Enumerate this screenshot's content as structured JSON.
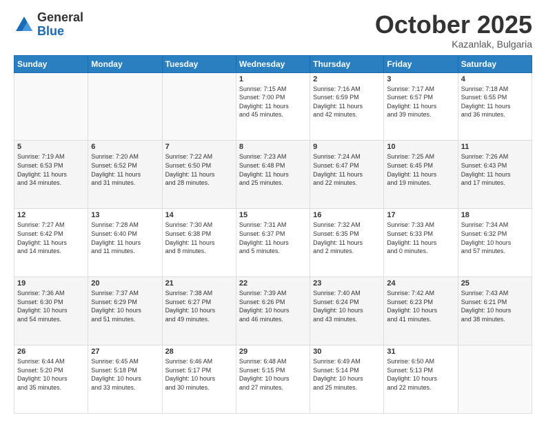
{
  "logo": {
    "general": "General",
    "blue": "Blue"
  },
  "title": {
    "month": "October 2025",
    "location": "Kazanlak, Bulgaria"
  },
  "headers": [
    "Sunday",
    "Monday",
    "Tuesday",
    "Wednesday",
    "Thursday",
    "Friday",
    "Saturday"
  ],
  "weeks": [
    [
      {
        "day": "",
        "info": ""
      },
      {
        "day": "",
        "info": ""
      },
      {
        "day": "",
        "info": ""
      },
      {
        "day": "1",
        "info": "Sunrise: 7:15 AM\nSunset: 7:00 PM\nDaylight: 11 hours\nand 45 minutes."
      },
      {
        "day": "2",
        "info": "Sunrise: 7:16 AM\nSunset: 6:59 PM\nDaylight: 11 hours\nand 42 minutes."
      },
      {
        "day": "3",
        "info": "Sunrise: 7:17 AM\nSunset: 6:57 PM\nDaylight: 11 hours\nand 39 minutes."
      },
      {
        "day": "4",
        "info": "Sunrise: 7:18 AM\nSunset: 6:55 PM\nDaylight: 11 hours\nand 36 minutes."
      }
    ],
    [
      {
        "day": "5",
        "info": "Sunrise: 7:19 AM\nSunset: 6:53 PM\nDaylight: 11 hours\nand 34 minutes."
      },
      {
        "day": "6",
        "info": "Sunrise: 7:20 AM\nSunset: 6:52 PM\nDaylight: 11 hours\nand 31 minutes."
      },
      {
        "day": "7",
        "info": "Sunrise: 7:22 AM\nSunset: 6:50 PM\nDaylight: 11 hours\nand 28 minutes."
      },
      {
        "day": "8",
        "info": "Sunrise: 7:23 AM\nSunset: 6:48 PM\nDaylight: 11 hours\nand 25 minutes."
      },
      {
        "day": "9",
        "info": "Sunrise: 7:24 AM\nSunset: 6:47 PM\nDaylight: 11 hours\nand 22 minutes."
      },
      {
        "day": "10",
        "info": "Sunrise: 7:25 AM\nSunset: 6:45 PM\nDaylight: 11 hours\nand 19 minutes."
      },
      {
        "day": "11",
        "info": "Sunrise: 7:26 AM\nSunset: 6:43 PM\nDaylight: 11 hours\nand 17 minutes."
      }
    ],
    [
      {
        "day": "12",
        "info": "Sunrise: 7:27 AM\nSunset: 6:42 PM\nDaylight: 11 hours\nand 14 minutes."
      },
      {
        "day": "13",
        "info": "Sunrise: 7:28 AM\nSunset: 6:40 PM\nDaylight: 11 hours\nand 11 minutes."
      },
      {
        "day": "14",
        "info": "Sunrise: 7:30 AM\nSunset: 6:38 PM\nDaylight: 11 hours\nand 8 minutes."
      },
      {
        "day": "15",
        "info": "Sunrise: 7:31 AM\nSunset: 6:37 PM\nDaylight: 11 hours\nand 5 minutes."
      },
      {
        "day": "16",
        "info": "Sunrise: 7:32 AM\nSunset: 6:35 PM\nDaylight: 11 hours\nand 2 minutes."
      },
      {
        "day": "17",
        "info": "Sunrise: 7:33 AM\nSunset: 6:33 PM\nDaylight: 11 hours\nand 0 minutes."
      },
      {
        "day": "18",
        "info": "Sunrise: 7:34 AM\nSunset: 6:32 PM\nDaylight: 10 hours\nand 57 minutes."
      }
    ],
    [
      {
        "day": "19",
        "info": "Sunrise: 7:36 AM\nSunset: 6:30 PM\nDaylight: 10 hours\nand 54 minutes."
      },
      {
        "day": "20",
        "info": "Sunrise: 7:37 AM\nSunset: 6:29 PM\nDaylight: 10 hours\nand 51 minutes."
      },
      {
        "day": "21",
        "info": "Sunrise: 7:38 AM\nSunset: 6:27 PM\nDaylight: 10 hours\nand 49 minutes."
      },
      {
        "day": "22",
        "info": "Sunrise: 7:39 AM\nSunset: 6:26 PM\nDaylight: 10 hours\nand 46 minutes."
      },
      {
        "day": "23",
        "info": "Sunrise: 7:40 AM\nSunset: 6:24 PM\nDaylight: 10 hours\nand 43 minutes."
      },
      {
        "day": "24",
        "info": "Sunrise: 7:42 AM\nSunset: 6:23 PM\nDaylight: 10 hours\nand 41 minutes."
      },
      {
        "day": "25",
        "info": "Sunrise: 7:43 AM\nSunset: 6:21 PM\nDaylight: 10 hours\nand 38 minutes."
      }
    ],
    [
      {
        "day": "26",
        "info": "Sunrise: 6:44 AM\nSunset: 5:20 PM\nDaylight: 10 hours\nand 35 minutes."
      },
      {
        "day": "27",
        "info": "Sunrise: 6:45 AM\nSunset: 5:18 PM\nDaylight: 10 hours\nand 33 minutes."
      },
      {
        "day": "28",
        "info": "Sunrise: 6:46 AM\nSunset: 5:17 PM\nDaylight: 10 hours\nand 30 minutes."
      },
      {
        "day": "29",
        "info": "Sunrise: 6:48 AM\nSunset: 5:15 PM\nDaylight: 10 hours\nand 27 minutes."
      },
      {
        "day": "30",
        "info": "Sunrise: 6:49 AM\nSunset: 5:14 PM\nDaylight: 10 hours\nand 25 minutes."
      },
      {
        "day": "31",
        "info": "Sunrise: 6:50 AM\nSunset: 5:13 PM\nDaylight: 10 hours\nand 22 minutes."
      },
      {
        "day": "",
        "info": ""
      }
    ]
  ]
}
